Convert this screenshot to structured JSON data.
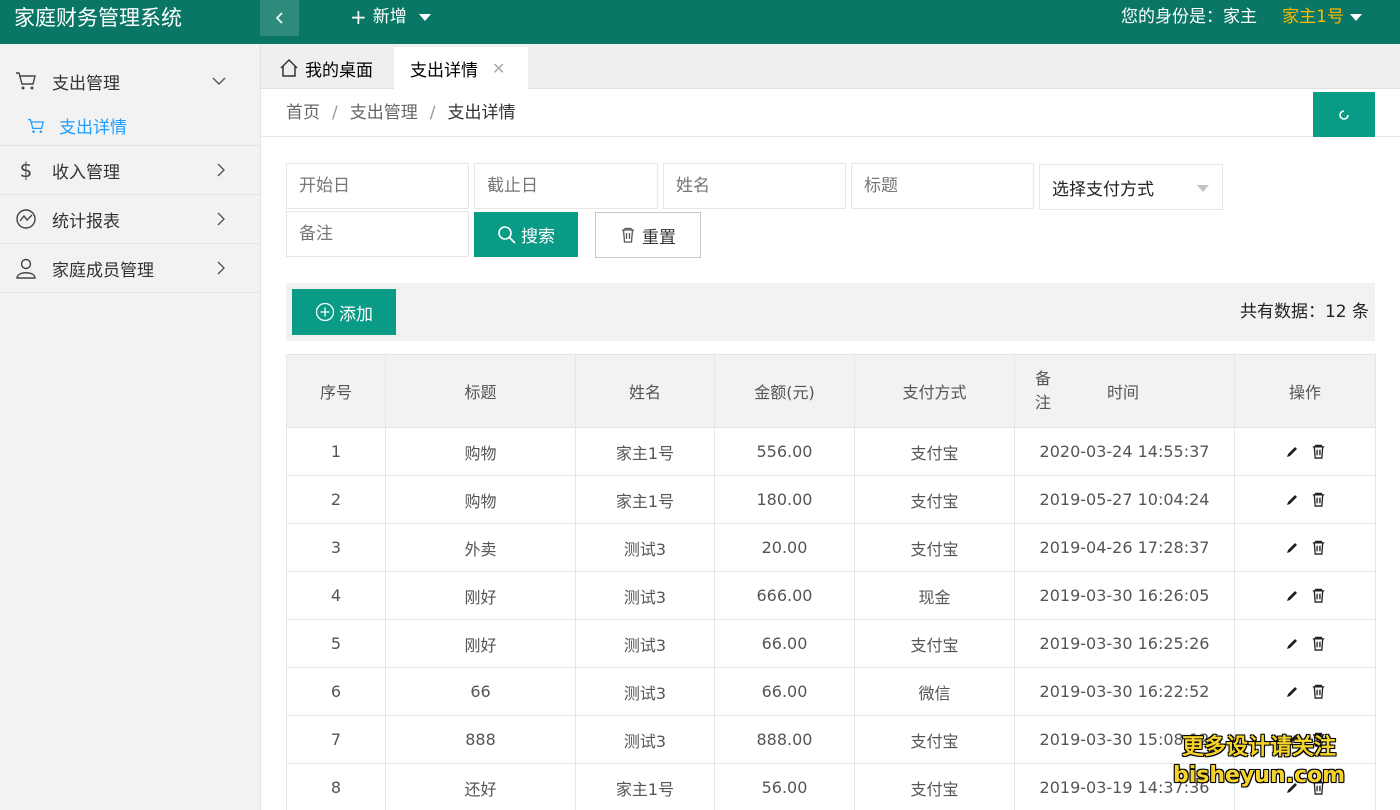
{
  "header": {
    "brand": "家庭财务管理系统",
    "add_label": "新增",
    "identity": "您的身份是：家主",
    "user": "家主1号"
  },
  "sidebar": {
    "items": [
      {
        "label": "支出管理",
        "icon": "cart-icon",
        "expanded": true
      },
      {
        "label": "收入管理",
        "icon": "dollar-icon"
      },
      {
        "label": "统计报表",
        "icon": "chart-trend-icon"
      },
      {
        "label": "家庭成员管理",
        "icon": "user-icon"
      }
    ],
    "sub_item": {
      "label": "支出详情",
      "icon": "cart-icon"
    }
  },
  "tabs": {
    "home": "我的桌面",
    "active": "支出详情"
  },
  "breadcrumb": {
    "home": "首页",
    "parent": "支出管理",
    "current": "支出详情"
  },
  "filters": {
    "start_date": "开始日",
    "end_date": "截止日",
    "name": "姓名",
    "title": "标题",
    "pay_method": "选择支付方式",
    "note": "备注",
    "search_label": "搜索",
    "reset_label": "重置"
  },
  "toolbar": {
    "add_label": "添加",
    "total": "共有数据：12 条"
  },
  "table": {
    "headers": {
      "index": "序号",
      "title": "标题",
      "name": "姓名",
      "amount": "金额(元)",
      "method": "支付方式",
      "note": "备注",
      "time": "时间",
      "ops": "操作"
    },
    "rows": [
      {
        "index": "1",
        "title": "购物",
        "name": "家主1号",
        "amount": "556.00",
        "method": "支付宝",
        "time": "2020-03-24 14:55:37"
      },
      {
        "index": "2",
        "title": "购物",
        "name": "家主1号",
        "amount": "180.00",
        "method": "支付宝",
        "time": "2019-05-27 10:04:24"
      },
      {
        "index": "3",
        "title": "外卖",
        "name": "测试3",
        "amount": "20.00",
        "method": "支付宝",
        "time": "2019-04-26 17:28:37"
      },
      {
        "index": "4",
        "title": "刚好",
        "name": "测试3",
        "amount": "666.00",
        "method": "现金",
        "time": "2019-03-30 16:26:05"
      },
      {
        "index": "5",
        "title": "刚好",
        "name": "测试3",
        "amount": "66.00",
        "method": "支付宝",
        "time": "2019-03-30 16:25:26"
      },
      {
        "index": "6",
        "title": "66",
        "name": "测试3",
        "amount": "66.00",
        "method": "微信",
        "time": "2019-03-30 16:22:52"
      },
      {
        "index": "7",
        "title": "888",
        "name": "测试3",
        "amount": "888.00",
        "method": "支付宝",
        "time": "2019-03-30 15:08:12"
      },
      {
        "index": "8",
        "title": "还好",
        "name": "家主1号",
        "amount": "56.00",
        "method": "支付宝",
        "time": "2019-03-19 14:37:36"
      }
    ]
  },
  "watermark": {
    "line1": "更多设计请关注",
    "line2": "bisheyun.com"
  },
  "colors": {
    "header": "#0a7766",
    "accent": "#0a9b86",
    "user": "#ffb800",
    "link": "#1e9fff"
  }
}
